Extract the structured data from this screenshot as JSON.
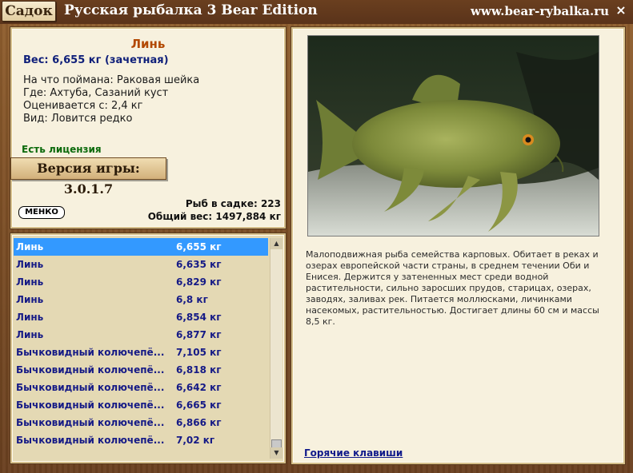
{
  "titlebar": {
    "sadok_button": "Садок",
    "title": "Русская рыбалка 3 Bear Edition",
    "site": "www.bear-rybalka.ru",
    "close": "×"
  },
  "info": {
    "fish_name": "Линь",
    "weight": "Вес: 6,655 кг (зачетная)",
    "caught_on": "На что поймана: Раковая шейка",
    "where": "Где: Ахтуба, Сазаний куст",
    "valued_from": "Оценивается с: 2,4 кг",
    "kind": "Вид: Ловится редко",
    "license": "Есть лицензия",
    "version": "Версия игры: 3.0.1.7",
    "logo": "МЕНКО",
    "fish_count": "Рыб в садке: 223",
    "total_weight": "Общий вес: 1497,884 кг"
  },
  "list": [
    {
      "name": "Линь",
      "weight": "6,655 кг"
    },
    {
      "name": "Линь",
      "weight": "6,635 кг"
    },
    {
      "name": "Линь",
      "weight": "6,829 кг"
    },
    {
      "name": "Линь",
      "weight": "6,8 кг"
    },
    {
      "name": "Линь",
      "weight": "6,854 кг"
    },
    {
      "name": "Линь",
      "weight": "6,877 кг"
    },
    {
      "name": "Бычковидный колючепё...",
      "weight": "7,105 кг"
    },
    {
      "name": "Бычковидный колючепё...",
      "weight": "6,818 кг"
    },
    {
      "name": "Бычковидный колючепё...",
      "weight": "6,642 кг"
    },
    {
      "name": "Бычковидный колючепё...",
      "weight": "6,665 кг"
    },
    {
      "name": "Бычковидный колючепё...",
      "weight": "6,866 кг"
    },
    {
      "name": "Бычковидный колючепё...",
      "weight": "7,02 кг"
    }
  ],
  "description": "Малоподвижная рыба семейства карповых. Обитает в реках и озерах европейской части страны, в среднем течении Оби и Енисея. Держится у затененных мест среди водной растительности, сильно заросших прудов, старицах, озерах, заводях, заливах рек. Питается моллюсками, личинками насекомых, растительностью. Достигает длины 60 см и массы 8,5 кг.",
  "hotkeys": "Горячие клавиши",
  "icons": {
    "photo": "tench-fish-photo",
    "scroll_up": "arrow-up-icon",
    "scroll_down": "arrow-down-icon"
  }
}
